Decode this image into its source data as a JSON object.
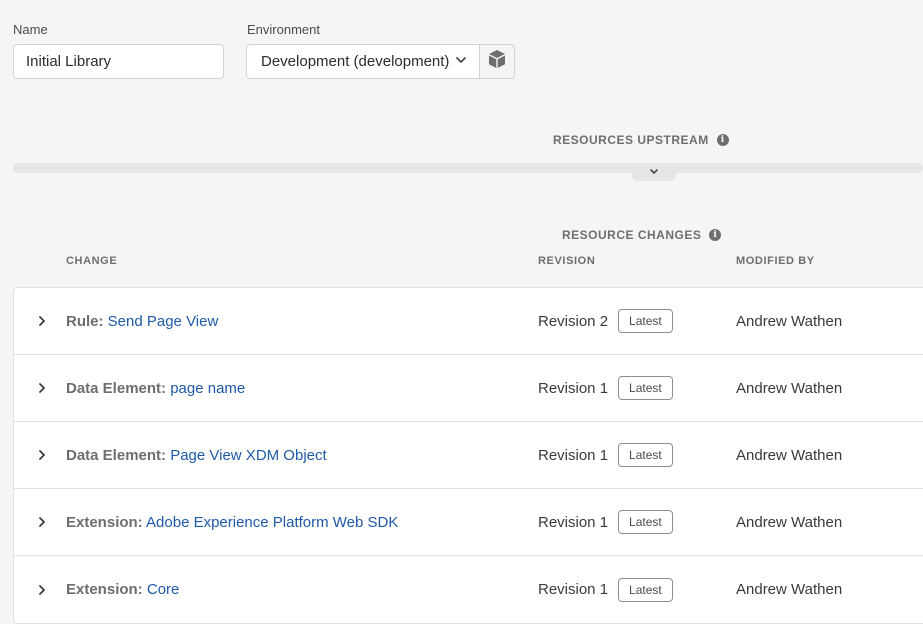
{
  "form": {
    "name_label": "Name",
    "name_value": "Initial Library",
    "environment_label": "Environment",
    "environment_value": "Development (development)"
  },
  "upstream": {
    "title": "RESOURCES UPSTREAM",
    "info_glyph": "i"
  },
  "changes": {
    "title": "RESOURCE CHANGES",
    "info_glyph": "i",
    "columns": {
      "change": "CHANGE",
      "revision": "REVISION",
      "modified_by": "MODIFIED BY"
    },
    "rows": [
      {
        "type": "Rule:",
        "name": "Send Page View",
        "revision": "Revision 2",
        "badge": "Latest",
        "modified_by": "Andrew Wathen"
      },
      {
        "type": "Data Element:",
        "name": "page name",
        "revision": "Revision 1",
        "badge": "Latest",
        "modified_by": "Andrew Wathen"
      },
      {
        "type": "Data Element:",
        "name": "Page View XDM Object",
        "revision": "Revision 1",
        "badge": "Latest",
        "modified_by": "Andrew Wathen"
      },
      {
        "type": "Extension:",
        "name": "Adobe Experience Platform Web SDK",
        "revision": "Revision 1",
        "badge": "Latest",
        "modified_by": "Andrew Wathen"
      },
      {
        "type": "Extension:",
        "name": "Core",
        "revision": "Revision 1",
        "badge": "Latest",
        "modified_by": "Andrew Wathen"
      }
    ]
  },
  "colors": {
    "link": "#1e5aa8",
    "background": "#f5f5f5"
  }
}
